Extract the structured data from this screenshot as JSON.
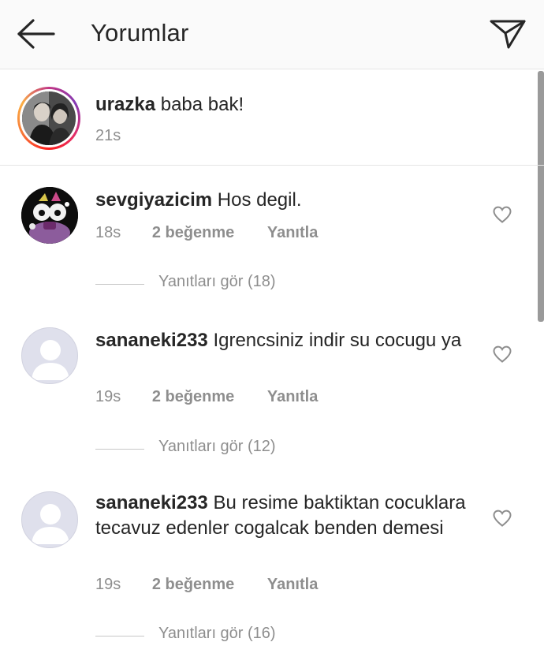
{
  "header": {
    "title": "Yorumlar",
    "back_icon": "arrow-left-icon",
    "send_icon": "paper-plane-icon"
  },
  "caption": {
    "username": "urazka",
    "text": "baba bak!",
    "time": "21s"
  },
  "comments": [
    {
      "username": "sevgiyazicim",
      "text": "Hos degil.",
      "time": "18s",
      "likes": "2 beğenme",
      "reply": "Yanıtla",
      "view_replies": "Yanıtları gör (18)"
    },
    {
      "username": "sananeki233",
      "text": "Igrencsiniz indir su cocugu ya",
      "time": "19s",
      "likes": "2 beğenme",
      "reply": "Yanıtla",
      "view_replies": "Yanıtları gör (12)"
    },
    {
      "username": "sananeki233",
      "text": "Bu resime baktiktan cocuklara tecavuz edenler cogalcak benden demesi",
      "time": "19s",
      "likes": "2 beğenme",
      "reply": "Yanıtla",
      "view_replies": "Yanıtları gör (16)"
    }
  ],
  "colors": {
    "text": "#262626",
    "secondary": "#8e8e8e",
    "header_bg": "#fafafa",
    "divider": "#e6e6e6",
    "default_avatar_bg": "#dfe0ec"
  }
}
